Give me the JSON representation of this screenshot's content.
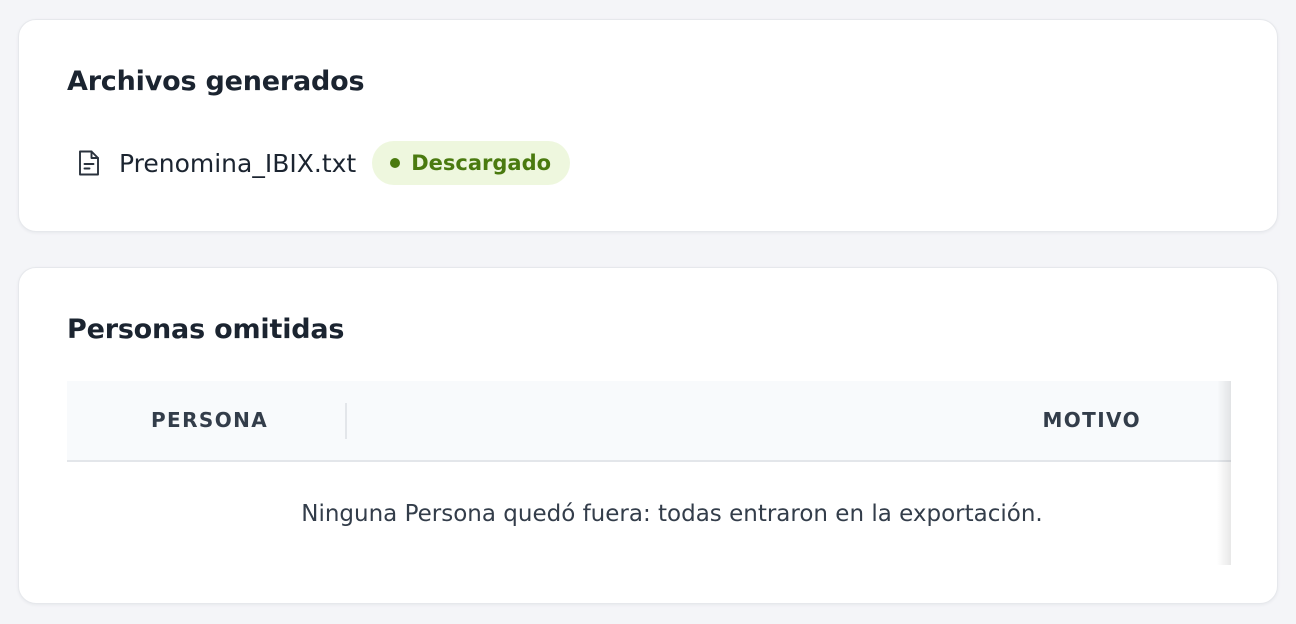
{
  "generated_files": {
    "title": "Archivos generados",
    "files": [
      {
        "icon": "file-text-icon",
        "name": "Prenomina_IBIX.txt",
        "status": "Descargado",
        "status_color": "#4a7a0f",
        "status_bg": "#eef7de"
      }
    ]
  },
  "omitted_people": {
    "title": "Personas omitidas",
    "columns": [
      "PERSONA",
      "MOTIVO"
    ],
    "empty_message": "Ninguna Persona quedó fuera: todas entraron en la exportación."
  }
}
